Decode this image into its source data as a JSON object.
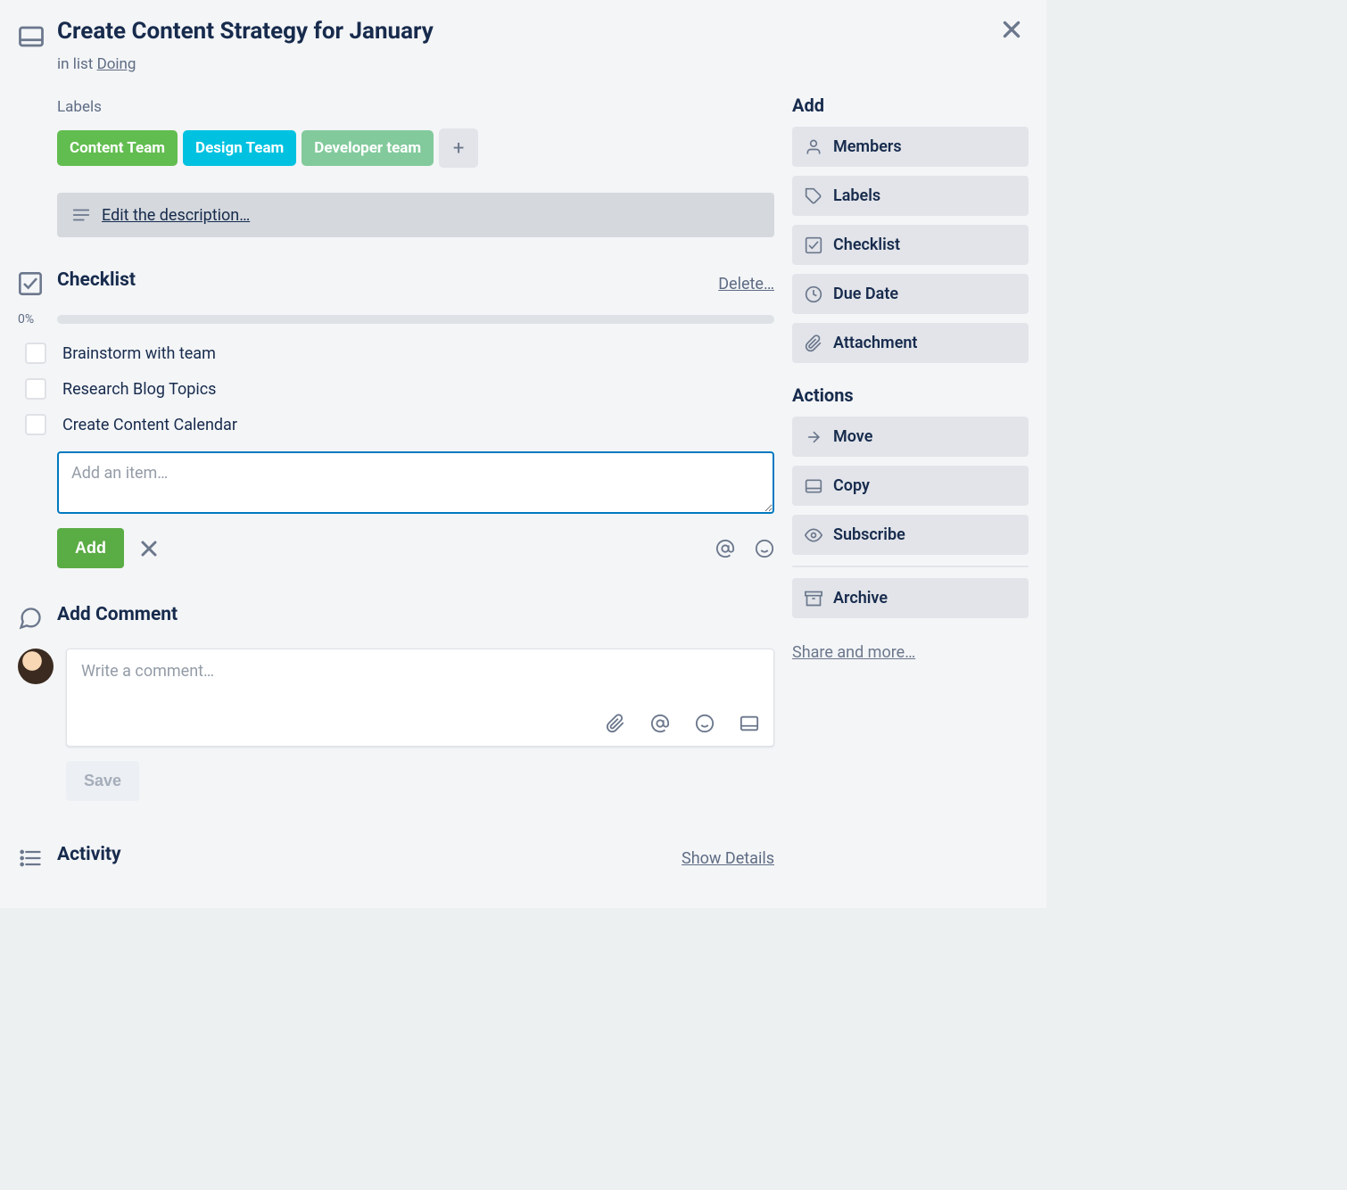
{
  "card": {
    "title": "Create Content Strategy for January",
    "in_list_prefix": "in list ",
    "list_name": "Doing"
  },
  "labels": {
    "heading": "Labels",
    "items": [
      {
        "text": "Content Team",
        "color": "green"
      },
      {
        "text": "Design Team",
        "color": "blue"
      },
      {
        "text": "Developer team",
        "color": "lime"
      }
    ],
    "add_label": "+"
  },
  "description": {
    "placeholder": "Edit the description…"
  },
  "checklist": {
    "title": "Checklist",
    "delete": "Delete…",
    "percent": "0%",
    "items": [
      {
        "label": "Brainstorm with team"
      },
      {
        "label": "Research Blog Topics"
      },
      {
        "label": "Create Content Calendar"
      }
    ],
    "add_item_placeholder": "Add an item…",
    "add_button": "Add"
  },
  "comments": {
    "title": "Add Comment",
    "placeholder": "Write a comment…",
    "save": "Save"
  },
  "activity": {
    "title": "Activity",
    "show_details": "Show Details"
  },
  "sidebar": {
    "add_heading": "Add",
    "add_items": [
      {
        "icon": "person",
        "label": "Members"
      },
      {
        "icon": "tag",
        "label": "Labels"
      },
      {
        "icon": "check",
        "label": "Checklist"
      },
      {
        "icon": "clock",
        "label": "Due Date"
      },
      {
        "icon": "paperclip",
        "label": "Attachment"
      }
    ],
    "actions_heading": "Actions",
    "action_items": [
      {
        "icon": "arrow",
        "label": "Move"
      },
      {
        "icon": "card",
        "label": "Copy"
      },
      {
        "icon": "eye",
        "label": "Subscribe"
      }
    ],
    "archive": {
      "icon": "archive",
      "label": "Archive"
    },
    "share": "Share and more…"
  }
}
